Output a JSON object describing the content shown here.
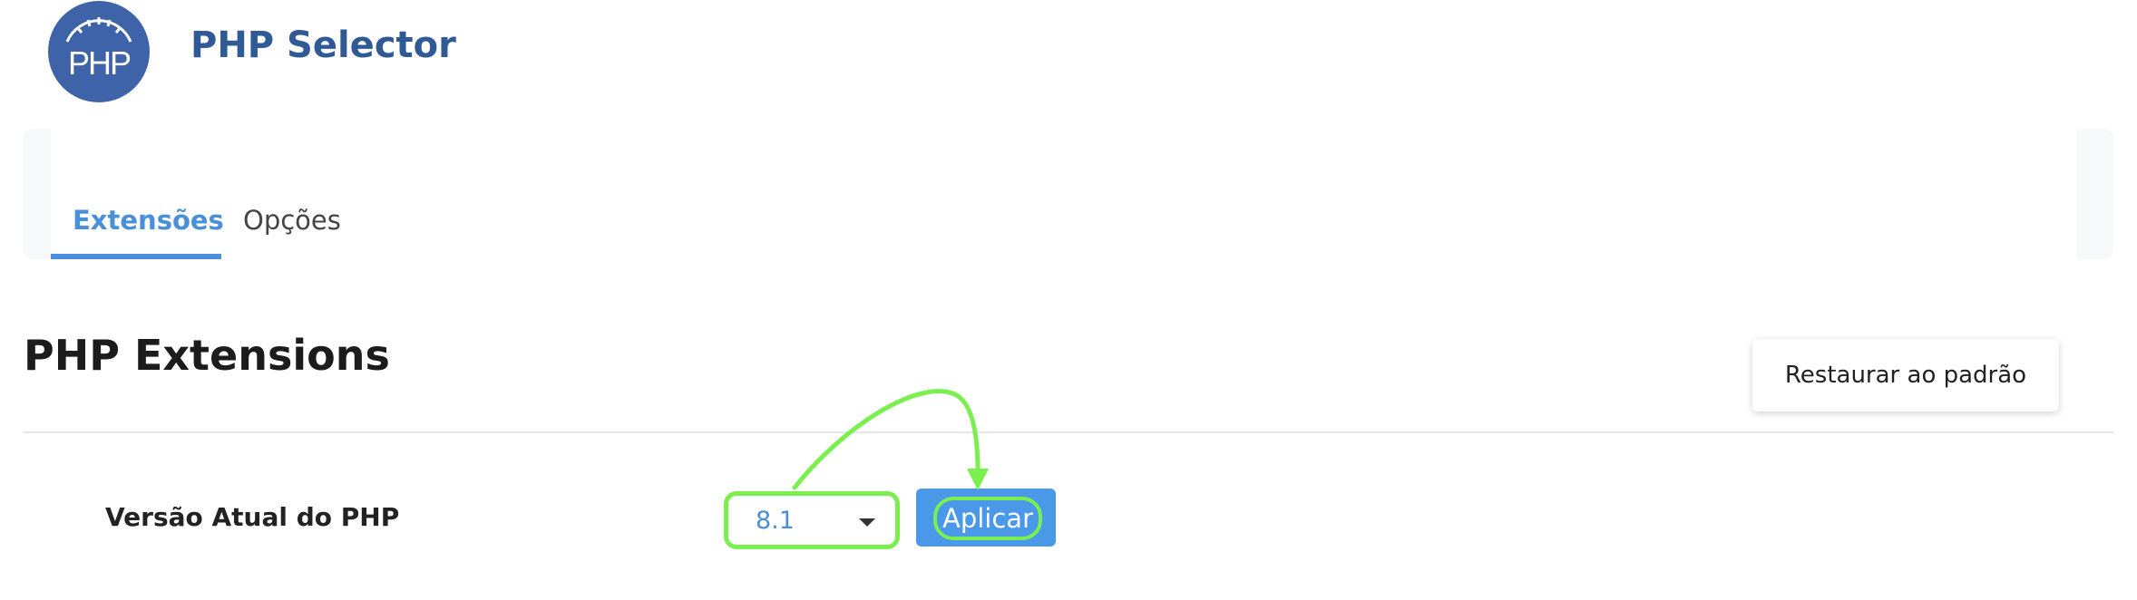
{
  "header": {
    "logo_text": "PHP",
    "title": "PHP Selector"
  },
  "tabs": [
    {
      "label": "Extensões",
      "active": true
    },
    {
      "label": "Opções",
      "active": false
    }
  ],
  "section": {
    "title": "PHP Extensions",
    "restore_label": "Restaurar ao padrão"
  },
  "php_version": {
    "label": "Versão Atual do PHP",
    "selected_value": "8.1",
    "apply_label": "Aplicar"
  },
  "colors": {
    "brand": "#2f5a96",
    "accent": "#4a90d9",
    "annotation": "#7bef4f"
  }
}
